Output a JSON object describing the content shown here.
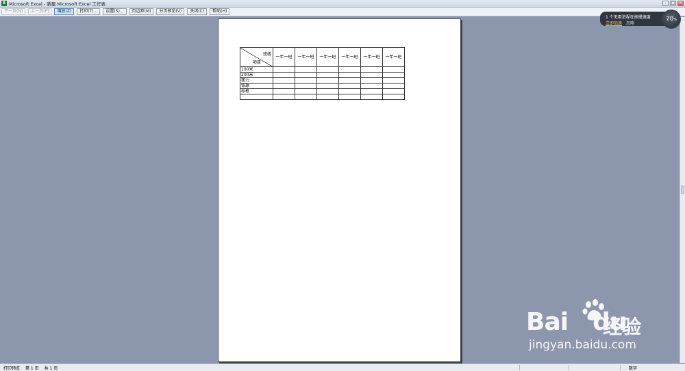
{
  "window": {
    "title": "Microsoft Excel - 新建 Microsoft Excel 工作表",
    "app_icon": "excel-icon"
  },
  "toolbar": {
    "buttons": [
      {
        "label": "下一页(N)",
        "enabled": false
      },
      {
        "label": "上一页(P)",
        "enabled": false
      },
      {
        "label": "缩放(Z)",
        "enabled": true,
        "active": true
      },
      {
        "label": "打印(T)...",
        "enabled": true
      },
      {
        "label": "设置(S)...",
        "enabled": true
      },
      {
        "label": "页边距(M)",
        "enabled": true
      },
      {
        "label": "分页预览(V)",
        "enabled": true
      },
      {
        "label": "关闭(C)",
        "enabled": true
      },
      {
        "label": "帮助(H)",
        "enabled": true
      }
    ]
  },
  "sheet": {
    "header_top": "班级",
    "header_bottom": "项目",
    "columns": [
      "一年一班",
      "一年一班",
      "一年一班",
      "一年一班",
      "一年一班",
      "一年一班"
    ],
    "rows": [
      "100米",
      "200米",
      "拔力",
      "铅球",
      "标枪",
      ""
    ]
  },
  "statusbar": {
    "mode": "打印预览",
    "page": "第 1 页",
    "total": "共 1 页",
    "num": "数字"
  },
  "popup": {
    "message": "1 个无用进程在拖慢速度",
    "action": "立即加速",
    "dismiss": "忽略",
    "gauge_value": "70",
    "gauge_unit": "%"
  },
  "watermark": {
    "brand": "Bai",
    "brand_suffix": "du",
    "product": "经验",
    "url": "jingyan.baidu.com"
  }
}
